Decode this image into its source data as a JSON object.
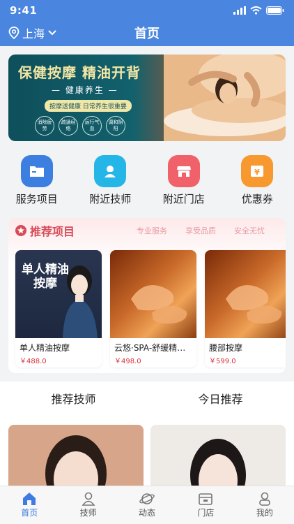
{
  "status": {
    "time": "9:41"
  },
  "header": {
    "city": "上海",
    "title": "首页"
  },
  "banner": {
    "headline": "保健按摩 精油开背",
    "subtitle": "— 健康养生 —",
    "pill": "按摩送健康 日常养生很重要",
    "chips": [
      "消除疲劳",
      "疏通经络",
      "运行气血",
      "调和阴阳"
    ]
  },
  "quick_actions": [
    {
      "label": "服务项目",
      "icon": "folder-icon",
      "color": "#3d7fe0"
    },
    {
      "label": "附近技师",
      "icon": "person-icon",
      "color": "#25b6e8"
    },
    {
      "label": "附近门店",
      "icon": "store-icon",
      "color": "#f0616a"
    },
    {
      "label": "优惠券",
      "icon": "coupon-icon",
      "color": "#f7992f"
    }
  ],
  "recommend": {
    "title": "推荐项目",
    "tags": [
      "专业服务",
      "享受品质",
      "安全无忧"
    ],
    "items": [
      {
        "name": "单人精油按摩",
        "price": "￥488.0",
        "overlay": "单人精油按摩"
      },
      {
        "name": "云悠·SPA-舒缓精油开背",
        "price": "￥498.0"
      },
      {
        "name": "腰部按摩",
        "price": "￥599.0"
      }
    ]
  },
  "tabs": {
    "left": "推荐技师",
    "right": "今日推荐"
  },
  "tabbar": [
    {
      "label": "首页",
      "icon": "home-icon",
      "active": true
    },
    {
      "label": "技师",
      "icon": "technician-icon",
      "active": false
    },
    {
      "label": "动态",
      "icon": "planet-icon",
      "active": false
    },
    {
      "label": "门店",
      "icon": "shop-icon",
      "active": false
    },
    {
      "label": "我的",
      "icon": "user-icon",
      "active": false
    }
  ],
  "colors": {
    "brand": "#4a86df",
    "accent_red": "#d94a57",
    "price": "#d9343f"
  }
}
